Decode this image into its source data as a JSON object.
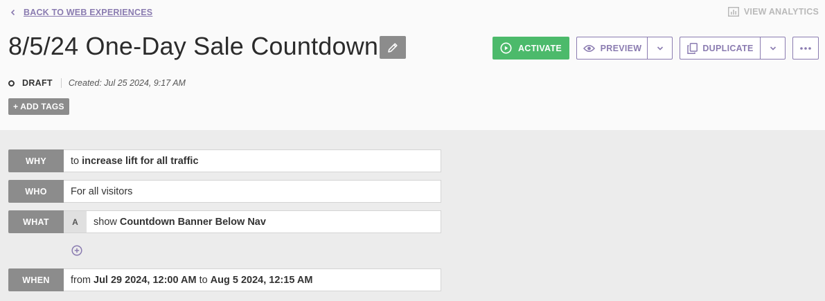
{
  "nav": {
    "back_label": "BACK TO WEB EXPERIENCES",
    "analytics_label": "VIEW ANALYTICS"
  },
  "header": {
    "title": "8/5/24 One-Day Sale Countdown",
    "status": "DRAFT",
    "created": "Created: Jul 25 2024, 9:17 AM",
    "add_tags_label": "+ ADD TAGS"
  },
  "actions": {
    "activate_label": "ACTIVATE",
    "preview_label": "PREVIEW",
    "duplicate_label": "DUPLICATE"
  },
  "rules": {
    "why": {
      "label": "WHY",
      "prefix": "to",
      "value": "increase lift for all traffic"
    },
    "who": {
      "label": "WHO",
      "value": "For all visitors"
    },
    "what": {
      "label": "WHAT",
      "variant": "A",
      "prefix": "show",
      "value": "Countdown Banner Below Nav"
    },
    "when": {
      "label": "WHEN",
      "prefix": "from",
      "start": "Jul 29 2024, 12:00 AM",
      "connector": "to",
      "end": "Aug 5 2024, 12:15 AM"
    }
  },
  "colors": {
    "accent": "#8a7bb0",
    "activate": "#4cba6b",
    "label_bg": "#8c8c8c",
    "content_bg": "#ececec"
  },
  "icons": {
    "back": "chevron-left-icon",
    "analytics": "bar-chart-icon",
    "edit": "pencil-icon",
    "activate": "play-circle-icon",
    "preview": "eye-icon",
    "duplicate": "copy-icon",
    "dropdown": "chevron-down-icon",
    "more": "more-horizontal-icon",
    "status": "status-circle-icon",
    "add": "plus-circle-icon"
  }
}
